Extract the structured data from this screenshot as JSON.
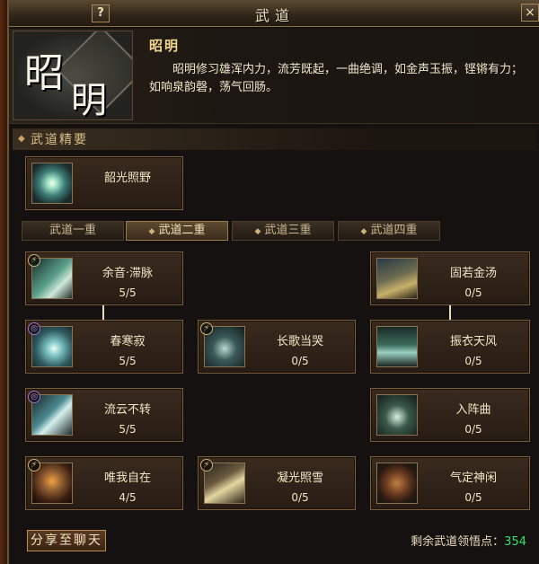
{
  "window": {
    "title": "武道",
    "help_label": "?",
    "close_label": "×"
  },
  "header": {
    "emblem_chars": [
      "昭",
      "明"
    ],
    "skill_name": "昭明",
    "description": "昭明修习雄浑内力，流芳既起，一曲绝调，如金声玉振，铿锵有力；如响泉韵磬，荡气回肠。"
  },
  "section": {
    "title": "武道精要"
  },
  "essence_skill": {
    "name": "韶光照野"
  },
  "tabs": [
    {
      "label": "武道一重",
      "active": false
    },
    {
      "label": "武道二重",
      "active": true
    },
    {
      "label": "武道三重",
      "active": false
    },
    {
      "label": "武道四重",
      "active": false
    }
  ],
  "skills": [
    {
      "name": "余音·滞脉",
      "level": "5/5",
      "badge": "⚡",
      "icon": "sound-wave-icon",
      "color": "#5aa08a"
    },
    {
      "name": "固若金汤",
      "level": "0/5",
      "badge": "",
      "icon": "golden-shield-icon",
      "color": "#6a6a50"
    },
    {
      "name": "春寒寂",
      "level": "5/5",
      "badge": "◎",
      "icon": "frost-burst-icon",
      "color": "#4a8a90"
    },
    {
      "name": "长歌当哭",
      "level": "0/5",
      "badge": "⚡",
      "icon": "sorrow-song-icon",
      "color": "#3a5a58"
    },
    {
      "name": "振衣天风",
      "level": "0/5",
      "badge": "",
      "icon": "wind-robe-icon",
      "color": "#3a6a5a"
    },
    {
      "name": "流云不转",
      "level": "5/5",
      "badge": "◎",
      "icon": "flowing-cloud-icon",
      "color": "#4a8a90"
    },
    {
      "name": "入阵曲",
      "level": "0/5",
      "badge": "",
      "icon": "battle-song-icon",
      "color": "#3a5a4a"
    },
    {
      "name": "唯我自在",
      "level": "4/5",
      "badge": "⚡",
      "icon": "warrior-fire-icon",
      "color": "#8a5a30"
    },
    {
      "name": "凝光照雪",
      "level": "0/5",
      "badge": "⚡",
      "icon": "light-snow-icon",
      "color": "#6a5a40"
    },
    {
      "name": "气定神闲",
      "level": "0/5",
      "badge": "",
      "icon": "calm-spirit-icon",
      "color": "#6a3a20"
    }
  ],
  "footer": {
    "share_label": "分享至聊天",
    "points_label": "剩余武道领悟点：",
    "points_value": "354"
  }
}
